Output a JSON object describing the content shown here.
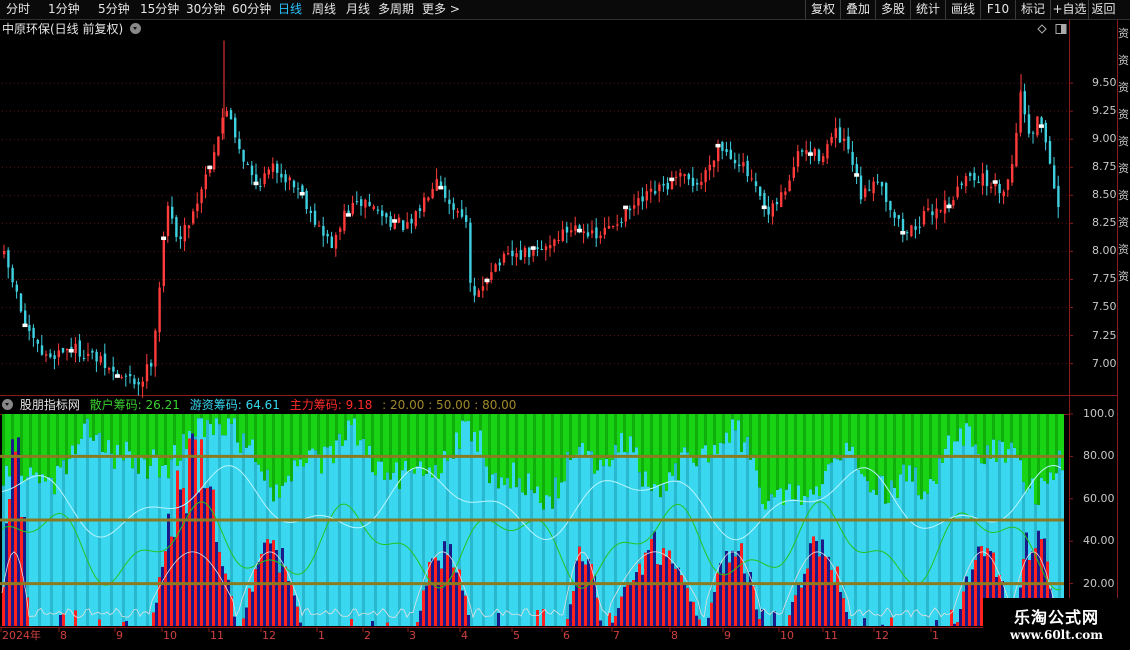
{
  "toolbar": {
    "periods": [
      "分时",
      "1分钟",
      "5分钟",
      "15分钟",
      "30分钟",
      "60分钟",
      "日线",
      "周线",
      "月线",
      "多周期",
      "更多 >"
    ],
    "active_period": "日线",
    "right_buttons": [
      "复权",
      "叠加",
      "多股",
      "统计",
      "画线",
      "F10",
      "标记",
      "+自选",
      "返回"
    ]
  },
  "main_chart": {
    "title": "中原环保(日线 前复权)",
    "price_axis": [
      "9.50",
      "9.25",
      "9.00",
      "8.75",
      "8.50",
      "8.25",
      "8.00",
      "7.75",
      "7.50",
      "7.25",
      "7.00"
    ],
    "ylim": [
      6.72,
      9.92
    ]
  },
  "indicator": {
    "name": "股朋指标网",
    "series_labels": [
      {
        "label": "散户筹码: 26.21",
        "color": "#39d22f"
      },
      {
        "label": "游资筹码: 64.61",
        "color": "#37d7f0"
      },
      {
        "label": "主力筹码: 9.18",
        "color": "#ff2b2b"
      },
      {
        "label": ": 20.00 : 50.00 : 80.00",
        "color": "#a08a2a"
      }
    ],
    "axis": [
      "100.0",
      "80.00",
      "60.00",
      "40.00",
      "20.00"
    ],
    "ref_lines": [
      20,
      50,
      80
    ]
  },
  "date_axis": [
    "2024年",
    "8",
    "9",
    "10",
    "11",
    "12",
    "1",
    "2",
    "3",
    "4",
    "5",
    "6",
    "7",
    "8",
    "9",
    "10",
    "11",
    "12",
    "1"
  ],
  "side_strip_text": "资资资资资资资资资资",
  "watermark": {
    "name": "乐淘公式网",
    "url": "www.60lt.com"
  },
  "colors": {
    "up": "#ff3b3b",
    "down": "#3fd0e0",
    "retail": "#19d414",
    "hot": "#3ad8f0",
    "main": "#ff2020",
    "navy": "#1a1a8a",
    "ref": "#8c7a20"
  }
}
